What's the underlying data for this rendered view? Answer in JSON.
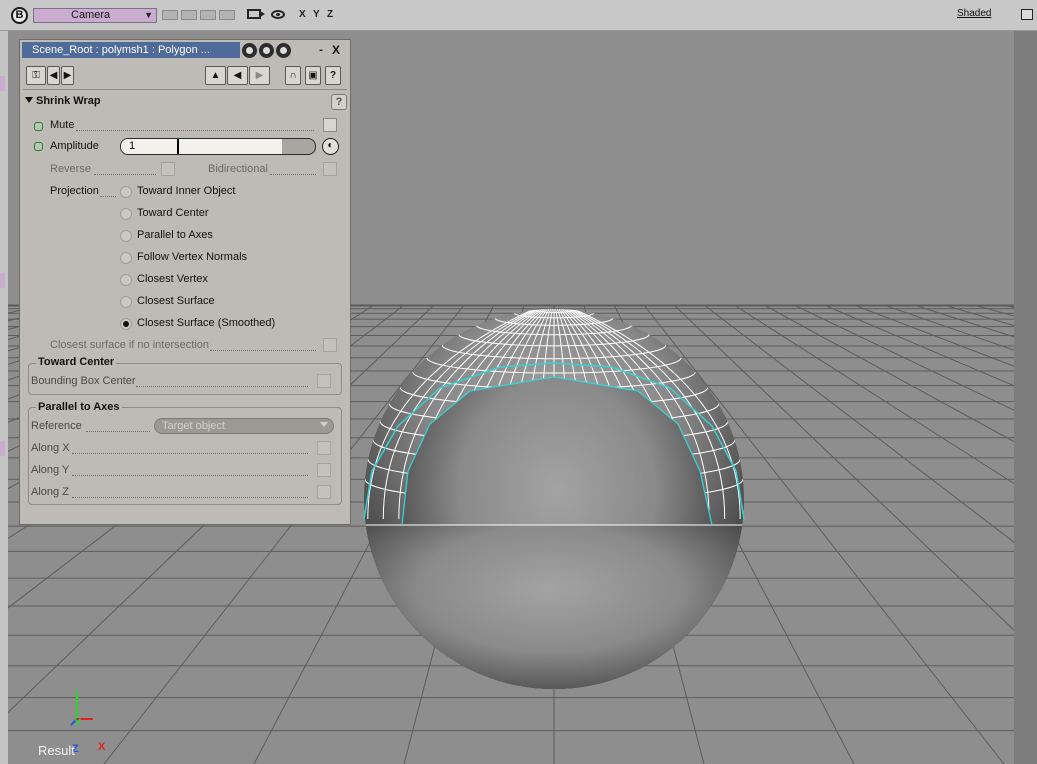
{
  "topbar": {
    "view_letter": "B",
    "camera_menu": "Camera",
    "axes_labels": [
      "X",
      "Y",
      "Z"
    ],
    "display_mode": "Shaded"
  },
  "viewport": {
    "result_label": "Result",
    "axis_indicator": {
      "x": "X",
      "y": "Y",
      "z": "Z"
    },
    "colors": {
      "background": "#8e8e8e",
      "grid": "#5a5a5a",
      "wireframe": "#ffffff",
      "selection_outline": "#36d1d1"
    }
  },
  "panel": {
    "title": "Scene_Root : polymsh1 : Polygon ...",
    "window_buttons": {
      "minimize": "-",
      "close": "X"
    },
    "toolbar_icons": [
      "key-icon",
      "arrow-left-icon",
      "arrow-right-icon",
      "up-icon",
      "back-icon",
      "forward-icon",
      "magnet-icon",
      "lock-icon",
      "help-icon"
    ],
    "help_glyph": "?",
    "section_title": "Shrink Wrap",
    "mute_label": "Mute",
    "amplitude": {
      "label": "Amplitude",
      "value": "1",
      "fill_fraction": 0.83
    },
    "reverse_label": "Reverse",
    "bidirectional_label": "Bidirectional",
    "projection": {
      "label": "Projection",
      "options": [
        "Toward Inner Object",
        "Toward Center",
        "Parallel to Axes",
        "Follow Vertex Normals",
        "Closest Vertex",
        "Closest Surface",
        "Closest Surface (Smoothed)"
      ],
      "selected": "Closest Surface (Smoothed)"
    },
    "closest_if_no_intersection_label": "Closest surface if no intersection",
    "toward_center_group": {
      "title": "Toward Center",
      "bounding_box_label": "Bounding Box Center"
    },
    "parallel_group": {
      "title": "Parallel to Axes",
      "reference_label": "Reference",
      "reference_value": "Target object",
      "along_x": "Along X",
      "along_y": "Along Y",
      "along_z": "Along Z"
    }
  }
}
